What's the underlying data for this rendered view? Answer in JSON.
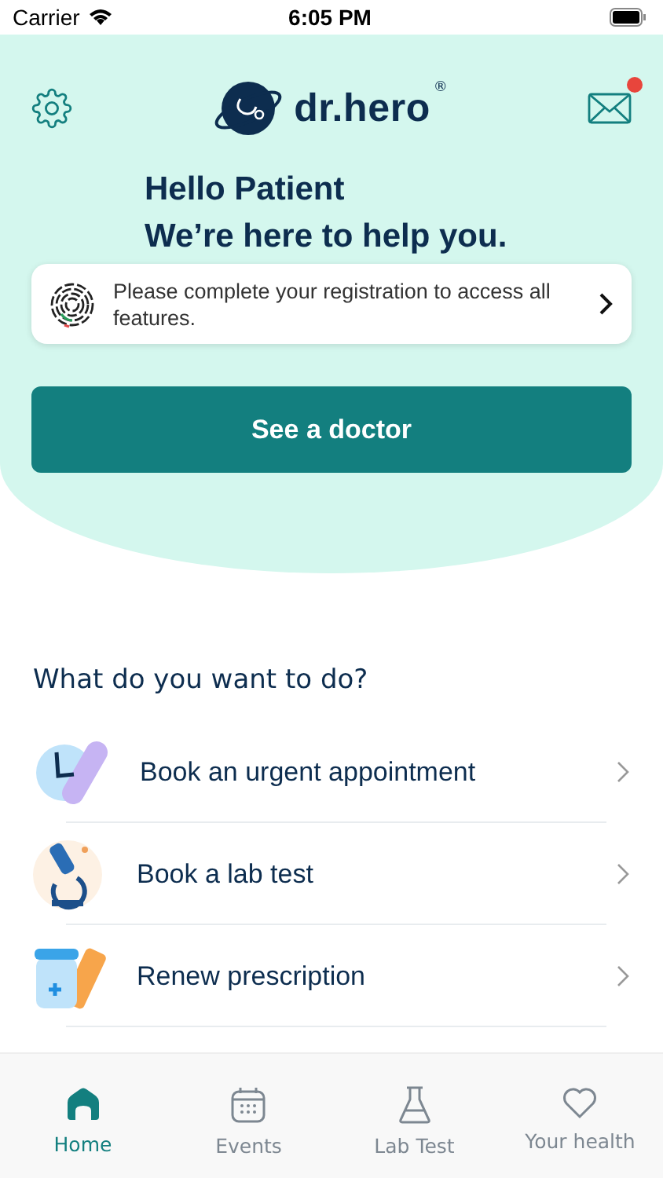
{
  "status_bar": {
    "carrier": "Carrier",
    "time": "6:05 PM"
  },
  "header": {
    "logo": "dr.hero",
    "registered_mark": "®",
    "has_notification": true
  },
  "greeting": {
    "line_1": "Hello Patient",
    "line_2": "We’re here to help you."
  },
  "registration_banner": {
    "text": "Please complete your registration to access all features."
  },
  "primary_button": {
    "label": "See a doctor"
  },
  "section_title": "What do you want to do?",
  "actions": [
    {
      "kind": "appointment",
      "label": "Book an urgent appointment"
    },
    {
      "kind": "lab",
      "label": "Book a lab test"
    },
    {
      "kind": "prescription",
      "label": "Renew prescription"
    }
  ],
  "tab_bar": [
    {
      "kind": "home",
      "label": "Home",
      "selected": true
    },
    {
      "kind": "events",
      "label": "Events",
      "selected": false
    },
    {
      "kind": "lab",
      "label": "Lab Test",
      "selected": false
    },
    {
      "kind": "health",
      "label": "Your health",
      "selected": false
    }
  ]
}
